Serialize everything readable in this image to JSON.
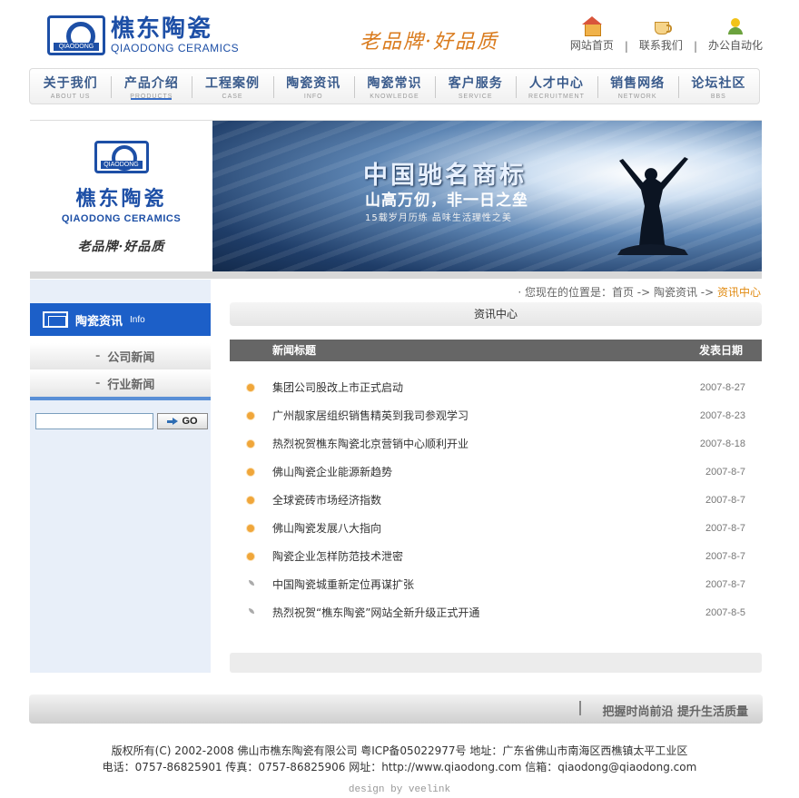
{
  "header": {
    "logo_cn": "樵东陶瓷",
    "logo_en": "QIAODONG CERAMICS",
    "logo_tag": "QIAODONG",
    "slogan": "老品牌·好品质",
    "links": [
      {
        "label": "网站首页",
        "icon": "home-icon"
      },
      {
        "label": "联系我们",
        "icon": "cup-icon"
      },
      {
        "label": "办公自动化",
        "icon": "person-icon"
      }
    ],
    "link_sep": "|"
  },
  "nav": {
    "items": [
      {
        "cn": "关于我们",
        "en": "ABOUT US"
      },
      {
        "cn": "产品介绍",
        "en": "PRODUCTS"
      },
      {
        "cn": "工程案例",
        "en": "CASE"
      },
      {
        "cn": "陶瓷资讯",
        "en": "INFO"
      },
      {
        "cn": "陶瓷常识",
        "en": "KNOWLEDGE"
      },
      {
        "cn": "客户服务",
        "en": "SERVICE"
      },
      {
        "cn": "人才中心",
        "en": "RECRUITMENT"
      },
      {
        "cn": "销售网络",
        "en": "NETWORK"
      },
      {
        "cn": "论坛社区",
        "en": "BBS"
      }
    ]
  },
  "banner": {
    "left_cn": "樵东陶瓷",
    "left_en": "QIAODONG CERAMICS",
    "left_tag": "QIAODONG",
    "left_slogan": "老品牌·好品质",
    "title": "中国驰名商标",
    "subtitle": "山高万仞，非一日之垒",
    "small": "15载岁月历练   品味生活理性之美"
  },
  "sidebar": {
    "title": "陶瓷资讯",
    "title_en": "Info",
    "items": [
      {
        "label": "公司新闻"
      },
      {
        "label": "行业新闻"
      }
    ],
    "item_dash": "-",
    "search_value": "",
    "go_label": "GO"
  },
  "breadcrumb": {
    "prefix": "· 您现在的位置是：首页 -> 陶瓷资讯 -> ",
    "current": "资讯中心"
  },
  "main": {
    "section_title": "资讯中心",
    "col_title": "新闻标题",
    "col_date": "发表日期",
    "news": [
      {
        "title": "集团公司股改上市正式启动",
        "date": "2007-8-27",
        "bullet": "dot"
      },
      {
        "title": "广州靓家居组织销售精英到我司参观学习",
        "date": "2007-8-23",
        "bullet": "dot"
      },
      {
        "title": "热烈祝贺樵东陶瓷北京营销中心顺利开业",
        "date": "2007-8-18",
        "bullet": "dot"
      },
      {
        "title": "佛山陶瓷企业能源新趋势",
        "date": "2007-8-7",
        "bullet": "dot"
      },
      {
        "title": "全球瓷砖市场经济指数",
        "date": "2007-8-7",
        "bullet": "dot"
      },
      {
        "title": "佛山陶瓷发展八大指向",
        "date": "2007-8-7",
        "bullet": "dot"
      },
      {
        "title": "陶瓷企业怎样防范技术泄密",
        "date": "2007-8-7",
        "bullet": "dot"
      },
      {
        "title": "中国陶瓷城重新定位再谋扩张",
        "date": "2007-8-7",
        "bullet": "leaf"
      },
      {
        "title": "热烈祝贺“樵东陶瓷”网站全新升级正式开通",
        "date": "2007-8-5",
        "bullet": "leaf"
      }
    ]
  },
  "footer": {
    "bar_slogan": "把握时尚前沿 提升生活质量",
    "line1": "版权所有(C) 2002-2008 佛山市樵东陶瓷有限公司   粤ICP备05022977号   地址：广东省佛山市南海区西樵镇太平工业区",
    "line2": "电话：0757-86825901  传真：0757-86825906  网址：http://www.qiaodong.com  信箱：qiaodong@qiaodong.com",
    "design": "design by veelink"
  },
  "colors": {
    "brand_blue": "#1d4fa6",
    "sidebar_head": "#1c5fc8",
    "accent_orange": "#e18a10",
    "list_head": "#666666"
  }
}
